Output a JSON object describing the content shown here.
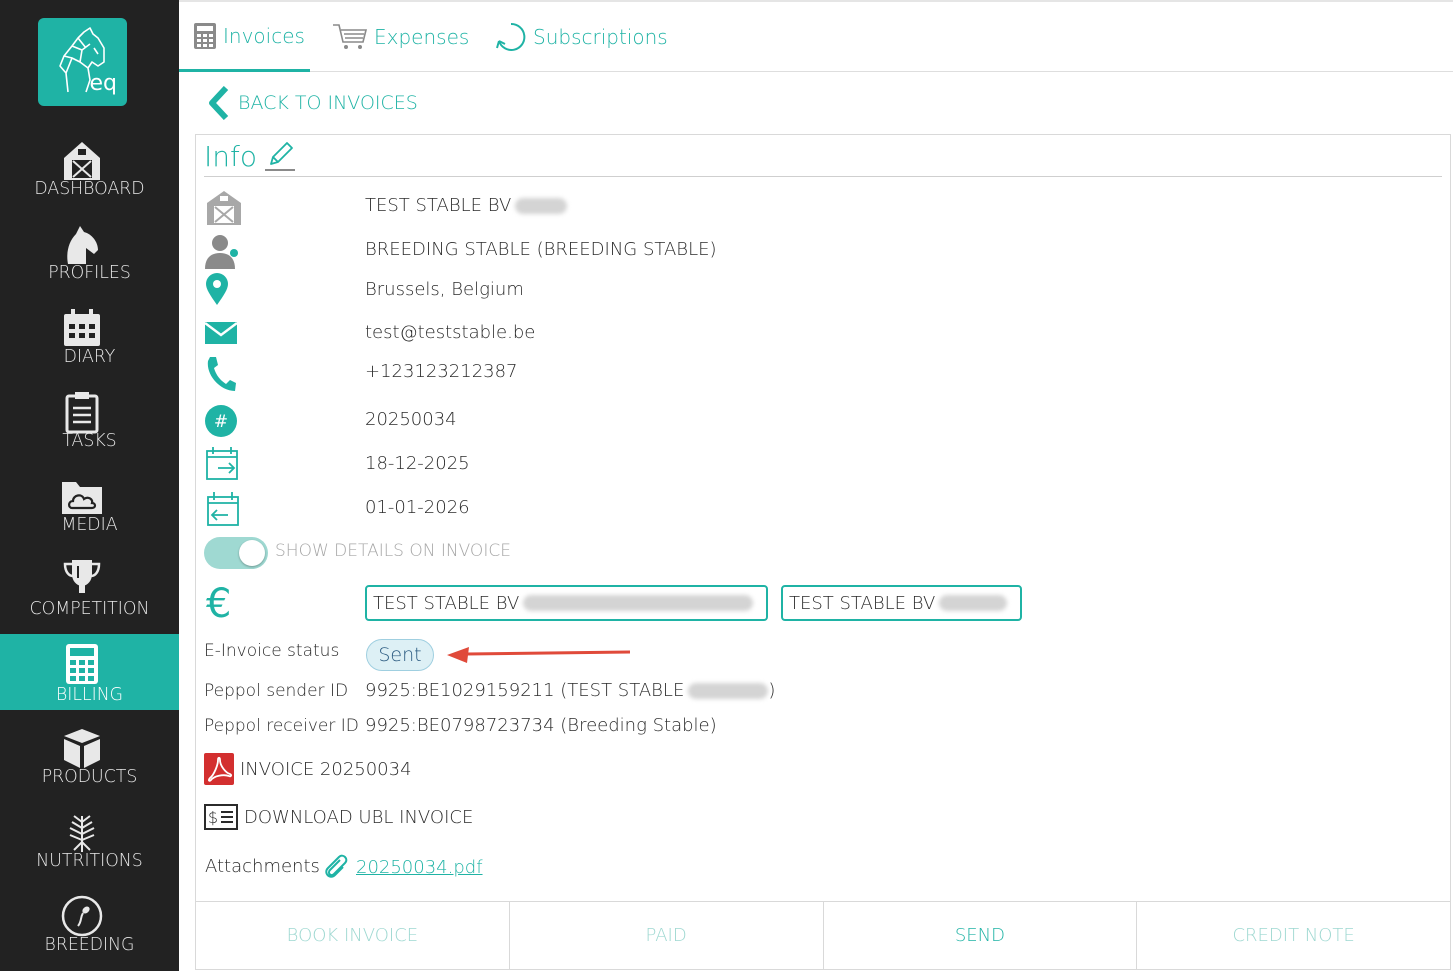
{
  "app": {
    "logo_text": "eq"
  },
  "sidebar": {
    "items": [
      {
        "label": "DASHBOARD",
        "icon": "barn-icon"
      },
      {
        "label": "PROFILES",
        "icon": "horse-head-icon"
      },
      {
        "label": "DIARY",
        "icon": "calendar-icon"
      },
      {
        "label": "TASKS",
        "icon": "clipboard-icon"
      },
      {
        "label": "MEDIA",
        "icon": "cloud-folder-icon"
      },
      {
        "label": "COMPETITION",
        "icon": "trophy-icon"
      },
      {
        "label": "BILLING",
        "icon": "calculator-icon",
        "active": true
      },
      {
        "label": "PRODUCTS",
        "icon": "box-icon"
      },
      {
        "label": "NUTRITIONS",
        "icon": "wheat-icon"
      },
      {
        "label": "BREEDING",
        "icon": "sperm-icon"
      }
    ]
  },
  "tabs": [
    {
      "label": "Invoices",
      "icon": "calculator-icon",
      "active": true
    },
    {
      "label": "Expenses",
      "icon": "cart-icon"
    },
    {
      "label": "Subscriptions",
      "icon": "refresh-icon"
    }
  ],
  "back_link": "BACK TO INVOICES",
  "info": {
    "title": "Info",
    "stable": "TEST STABLE BV",
    "customer": "BREEDING STABLE (BREEDING STABLE)",
    "location": "Brussels, Belgium",
    "email": "test@teststable.be",
    "phone": "+123123212387",
    "invoice_number": "20250034",
    "invoice_date": "18-12-2025",
    "due_date": "01-01-2026",
    "show_details_label": "SHOW DETAILS ON INVOICE",
    "show_details_on": true,
    "currency_symbol": "€",
    "account_1": "TEST STABLE BV",
    "account_2": "TEST STABLE BV",
    "einvoice_label": "E-Invoice status",
    "einvoice_status": "Sent",
    "peppol_sender_label": "Peppol sender ID",
    "peppol_sender_value": "9925:BE1029159211 (TEST STABLE",
    "peppol_sender_suffix": ")",
    "peppol_receiver_label": "Peppol receiver ID",
    "peppol_receiver_value": "9925:BE0798723734 (Breeding Stable)",
    "pdf_label": "INVOICE 20250034",
    "ubl_label": "DOWNLOAD UBL INVOICE",
    "attachments_label": "Attachments",
    "attachment_file": "20250034.pdf"
  },
  "actions": [
    {
      "label": "BOOK INVOICE",
      "enabled": false
    },
    {
      "label": "PAID",
      "enabled": false
    },
    {
      "label": "SEND",
      "enabled": true
    },
    {
      "label": "CREDIT NOTE",
      "enabled": false
    }
  ],
  "colors": {
    "accent": "#1fb3a5",
    "sidebar": "#222222",
    "pdf_red": "#d32f2f",
    "arrow_red": "#e04a3a"
  }
}
